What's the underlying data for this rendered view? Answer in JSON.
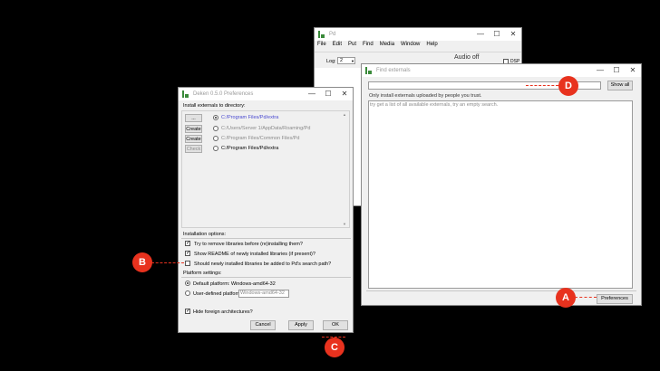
{
  "pd_window": {
    "title": "Pd",
    "menu": [
      "File",
      "Edit",
      "Put",
      "Find",
      "Media",
      "Window",
      "Help"
    ],
    "log_label": "Log:",
    "log_value": "2",
    "audio_status": "Audio off",
    "dsp_label": "DSP"
  },
  "find_window": {
    "title": "Find externals",
    "search_value": "",
    "show_all_label": "Show all",
    "trust_note": "Only install externals uploaded by people you trust.",
    "results_hint": "try get a list of all available externals, try an empty search.",
    "preferences_label": "Preferences"
  },
  "prefs_window": {
    "title": "Deken 0.5.0 Preferences",
    "section_install_dir": "Install externals to directory:",
    "dirs": [
      {
        "button": "...",
        "path": "C:/Program Files/Pd/extra",
        "selected": true,
        "enabled": true
      },
      {
        "button": "Create",
        "path": "C:/Users/Server 1/AppData/Roaming/Pd",
        "selected": false,
        "enabled": false
      },
      {
        "button": "Create",
        "path": "C:/Program Files/Common Files/Pd",
        "selected": false,
        "enabled": false
      },
      {
        "button": "Check",
        "path": "C:/Program Files/Pd/extra",
        "selected": false,
        "enabled": true
      }
    ],
    "section_install_options": "Installation options:",
    "options": [
      {
        "label": "Try to remove libraries before (re)installing them?",
        "checked": true
      },
      {
        "label": "Show README of newly installed libraries (if present)?",
        "checked": true
      },
      {
        "label": "Should newly installed libraries be added to Pd's search path?",
        "checked": false
      }
    ],
    "section_platform": "Platform settings:",
    "default_platform": "Default platform:  Windows-amd64-32",
    "user_platform_label": "User-defined platform:",
    "user_platform_value": "Windows-amd64-32",
    "hide_foreign": "Hide foreign architectures?",
    "cancel_label": "Cancel",
    "apply_label": "Apply",
    "ok_label": "OK"
  },
  "callouts": {
    "a": "A",
    "b": "B",
    "c": "C",
    "d": "D"
  },
  "colors": {
    "callout": "#e8321e",
    "link_blue": "#4a4ad0"
  }
}
